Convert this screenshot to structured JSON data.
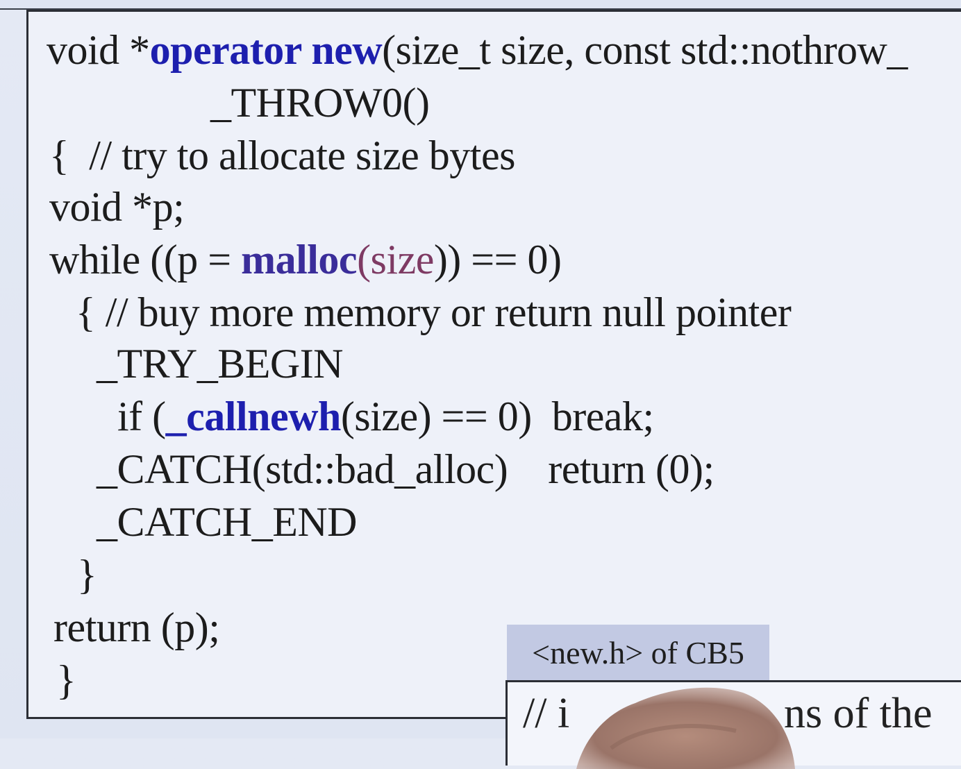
{
  "code": {
    "line1": {
      "prefix": "void *",
      "keyword": "operator new",
      "rest": "(size_t size, const std::nothrow_"
    },
    "line2": "_THROW0()",
    "line3": "{  // try to allocate size bytes",
    "line4": "void *p;",
    "line5": {
      "prefix": "while ((p = ",
      "keyword": "malloc",
      "arg": "(size",
      "rest": ")) == 0)"
    },
    "line6": "{ // buy more memory or return null pointer",
    "line7": "_TRY_BEGIN",
    "line8": {
      "prefix": "if (",
      "keyword": "_callnewh",
      "rest": "(size) == 0)  break;"
    },
    "line9": "_CATCH(std::bad_alloc)    return (0);",
    "line10": "_CATCH_END",
    "line11": "}",
    "line12": "return (p);",
    "line13": "}"
  },
  "caption": "<new.h> of CB5",
  "overlay_fragment": {
    "left": "// i",
    "right": "ns of the"
  },
  "colors": {
    "keyword": "#1d1fae",
    "keyword_alt": "#3a2d9a",
    "argument": "#7e3a63",
    "caption_bg": "#c2c9e3",
    "slide_bg": "#e4e9f4"
  },
  "icons": [
    "presenter-hand"
  ]
}
